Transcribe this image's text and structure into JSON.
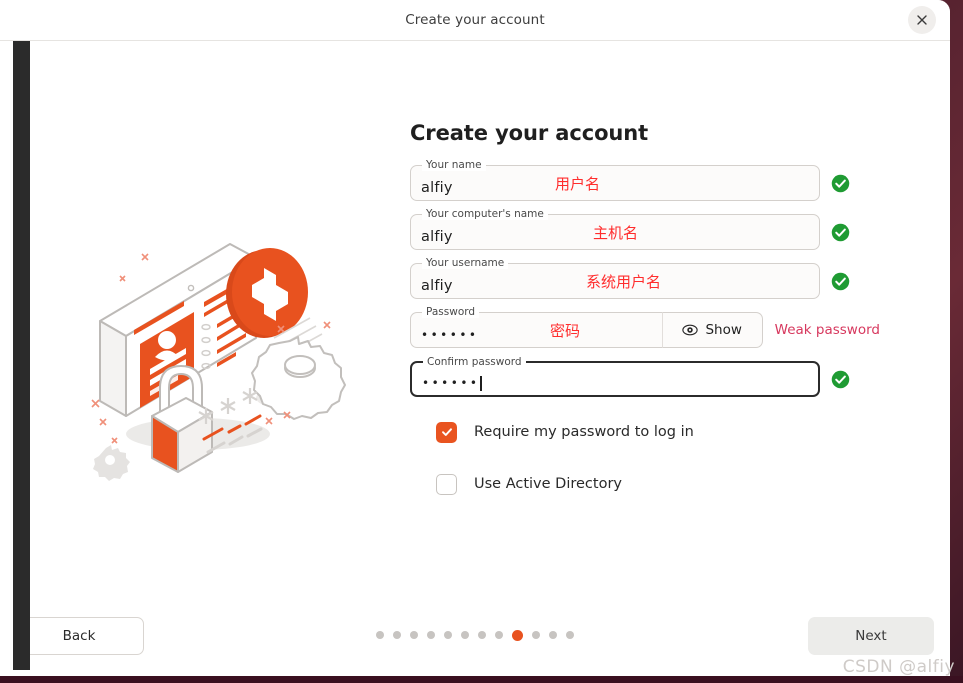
{
  "window": {
    "titlebar_title": "Create your account",
    "close_icon": "close-icon"
  },
  "main": {
    "heading": "Create your account",
    "fields": [
      {
        "label": "Your name",
        "value": "alfiy",
        "annotation": "用户名",
        "status": "valid",
        "status_icon": "green-check-icon"
      },
      {
        "label": "Your computer's name",
        "value": "alfiy",
        "annotation": "主机名",
        "status": "valid",
        "status_icon": "green-check-icon"
      },
      {
        "label": "Your username",
        "value": "alfiy",
        "annotation": "系统用户名",
        "status": "valid",
        "status_icon": "green-check-icon"
      }
    ],
    "password_field": {
      "label": "Password",
      "value": "••••••",
      "annotation": "密码",
      "show_button_label": "Show",
      "show_button_icon": "eye-icon",
      "hint": "Weak password"
    },
    "confirm_field": {
      "label": "Confirm password",
      "value": "••••••",
      "status_icon": "green-check-icon",
      "focused": true
    },
    "options": [
      {
        "label": "Require my password to log in",
        "checked": true
      },
      {
        "label": "Use Active Directory",
        "checked": false
      }
    ]
  },
  "footer": {
    "back_label": "Back",
    "next_label": "Next",
    "dots_total": 12,
    "dots_active_index": 8
  },
  "watermark": "CSDN @alfiy",
  "colors": {
    "accent_orange": "#e95420",
    "active_dot": "#e8521f",
    "valid_green": "#1f9b33",
    "warning_red": "#d7385e",
    "annotation_red": "#ff2d2d"
  }
}
